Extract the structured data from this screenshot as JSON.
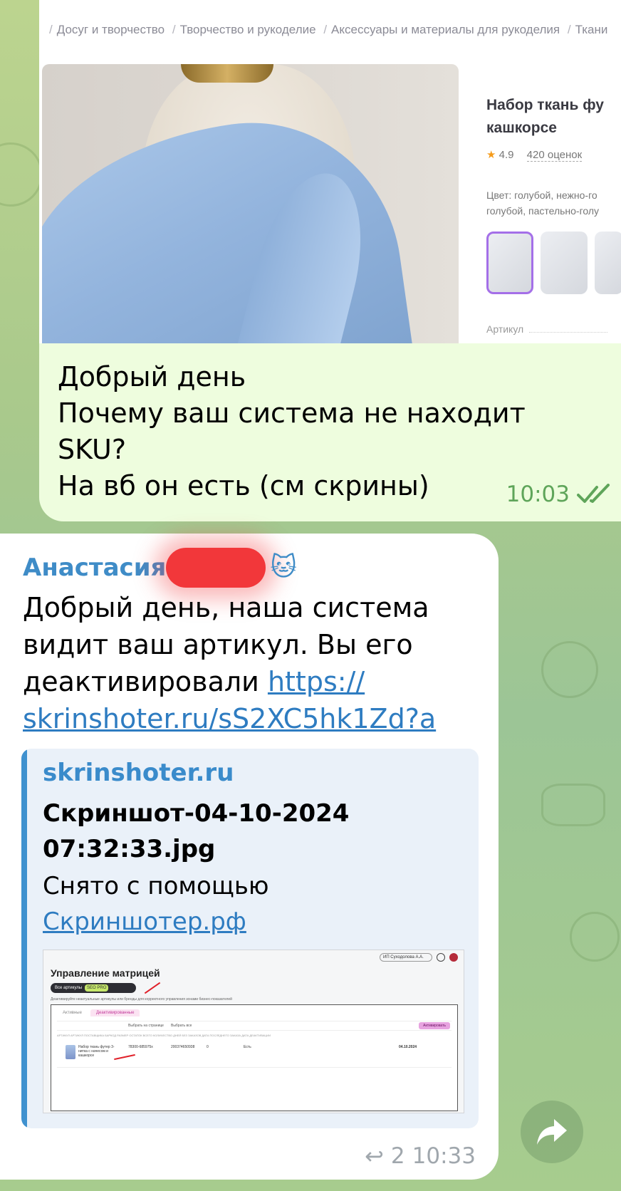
{
  "theme": {
    "accent": "#3f8cc7",
    "outgoing_bubble": "#eefdde",
    "incoming_bubble": "#ffffff",
    "read_check": "#5fa55a",
    "redaction": "#f2373a"
  },
  "outgoing": {
    "screenshot": {
      "breadcrumbs": [
        "Досуг и творчество",
        "Творчество и рукоделие",
        "Аксессуары и материалы для рукоделия",
        "Ткани"
      ],
      "product_title_line1": "Набор ткань фу",
      "product_title_line2": "кашкорсе",
      "rating": "4.9",
      "reviews": "420 оценок",
      "color_line1": "Цвет: голубой, нежно-го",
      "color_line2": "голубой, пастельно-голу",
      "article_label": "Артикул"
    },
    "text_lines": [
      "Добрый день",
      "Почему ваш система не находит",
      "SKU?",
      "На вб он есть (см скрины)"
    ],
    "time": "10:03"
  },
  "incoming": {
    "sender": "Анастасия",
    "sender_icon": "cat-emoji",
    "text": "Добрый день, наша система видит ваш артикул. Вы его деактивировали ",
    "link": "https://skrinshoter.ru/sS2XC5hk1Zd?a",
    "link_line1": "https://",
    "link_line2": "skrinshoter.ru/sS2XC5hk1Zd?a",
    "preview": {
      "site": "skrinshoter.ru",
      "title_line1": "Скриншот-04-10-2024",
      "title_line2": "07:32:33.jpg",
      "desc": "Снято с помощью",
      "desc_link": "Скриншотер.рф",
      "mini": {
        "title": "Управление матрицей",
        "account": "ИП Суходолова А.А.",
        "pill": "Все артикулы",
        "pill_badge": "SEO PRO",
        "hint": "Деактивируйте неактуальные артикулы или бренды для корректного управления зонами бизнес-показателей",
        "tab_active": "Активные",
        "tab_deactivated": "Деактивированные",
        "toolbar_1": "Выбрать на странице",
        "toolbar_2": "Выбрать все",
        "toolbar_button": "Активировать",
        "headers": "АРТИКУЛ     АРТИКУЛ ПОСТАВЩИКА     БАРКОД     РАЗМЕР     ОСТАТОК ВСЕГО     КОЛИЧЕСТВО ДНЕЙ БЕЗ ЗАКАЗОВ     ДАТА ПОСЛЕДНЕГО ЗАКАЗА     ДАТА ДЕАКТИВАЦИИ",
        "row_name": "Набор ткань футер 3-нитка с начесом и кашкорсе",
        "row_c2": "78300-685975x",
        "row_c3": "200374650938",
        "row_c4": "0",
        "row_c5": "Есть",
        "row_date": "04.10.2024"
      }
    },
    "replies": "2",
    "time": "10:33"
  }
}
